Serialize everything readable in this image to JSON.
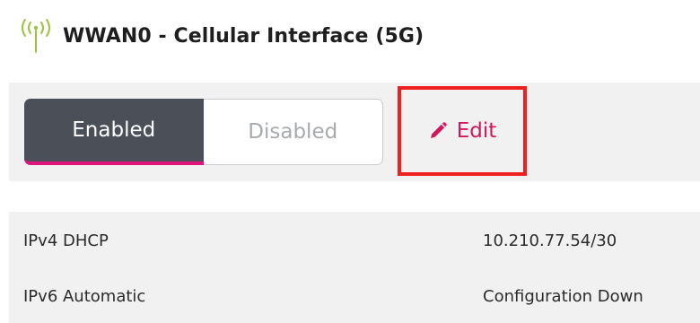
{
  "header": {
    "title": "WWAN0 - Cellular Interface (5G)",
    "icon": "antenna-signal-icon",
    "icon_color": "#9ac43c"
  },
  "toolbar": {
    "state_toggle": {
      "options": [
        "Enabled",
        "Disabled"
      ],
      "selected": "Enabled"
    },
    "edit_label": "Edit",
    "edit_icon": "pencil-icon"
  },
  "details": [
    {
      "label": "IPv4 DHCP",
      "value": "10.210.77.54/30"
    },
    {
      "label": "IPv6 Automatic",
      "value": "Configuration Down"
    }
  ],
  "colors": {
    "accent": "#e0147a",
    "edit_text": "#d4175d",
    "highlight_box": "#ee1f1f",
    "enabled_bg": "#4b4f57",
    "panel_bg": "#f1f1f1"
  }
}
